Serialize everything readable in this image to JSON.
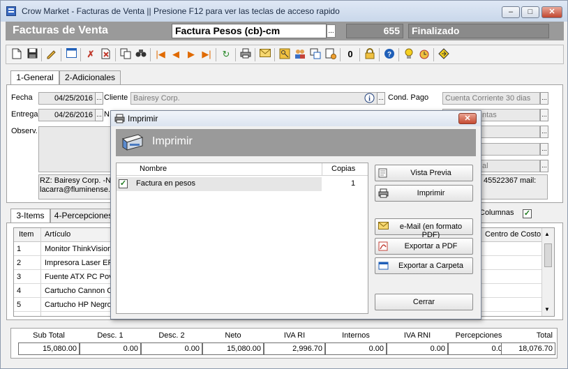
{
  "window": {
    "title": "Crow Market - Facturas de Venta || Presione F12 para ver las teclas de acceso rapido"
  },
  "header": {
    "title": "Facturas de Venta",
    "doc_type": "Factura Pesos (cb)-cm",
    "number": "655",
    "status": "Finalizado"
  },
  "tabs_top": [
    "1-General",
    "2-Adicionales"
  ],
  "form": {
    "fecha_label": "Fecha",
    "fecha": "04/25/2016",
    "entrega_label": "Entrega",
    "entrega": "04/26/2016",
    "observ_label": "Observ.",
    "cliente_label": "Cliente",
    "cliente": "Bairesy Corp.",
    "n_label": "N",
    "cond_pago_label": "Cond. Pago",
    "cond_pago": "Cuenta Corriente 30 dias",
    "right_field_2": "ntas",
    "right_field_5": "al",
    "rz_line1": "RZ: Bairesy Corp. -N:",
    "rz_line2": "lacarra@fluminense.c",
    "phone_fragment": "45522367 mail:"
  },
  "tabs_bottom": [
    "3-Items",
    "4-Percepciones"
  ],
  "items_grid": {
    "columns": [
      "Item",
      "Artículo"
    ],
    "rows": [
      {
        "item": "1",
        "articulo": "Monitor ThinkVision"
      },
      {
        "item": "2",
        "articulo": "Impresora Laser EPL"
      },
      {
        "item": "3",
        "articulo": "Fuente ATX PC Pov"
      },
      {
        "item": "4",
        "articulo": "Cartucho Cannon Co"
      },
      {
        "item": "5",
        "articulo": "Cartucho HP Negro"
      }
    ],
    "columnas_label": "Columnas",
    "centro_costo_label": "Centro de Costo"
  },
  "totals": [
    {
      "label": "Sub Total",
      "value": "15,080.00"
    },
    {
      "label": "Desc. 1",
      "value": "0.00"
    },
    {
      "label": "Desc. 2",
      "value": "0.00"
    },
    {
      "label": "Neto",
      "value": "15,080.00"
    },
    {
      "label": "IVA RI",
      "value": "2,996.70"
    },
    {
      "label": "Internos",
      "value": "0.00"
    },
    {
      "label": "IVA RNI",
      "value": "0.00"
    },
    {
      "label": "Percepciones",
      "value": "0.00"
    },
    {
      "label": "Total",
      "value": "18,076.70"
    }
  ],
  "dialog": {
    "title": "Imprimir",
    "heading": "Imprimir",
    "list_columns": {
      "nombre": "Nombre",
      "copias": "Copias"
    },
    "rows": [
      {
        "nombre": "Factura en pesos",
        "copias": "1",
        "checked": true
      }
    ],
    "buttons": {
      "vista_previa": "Vista Previa",
      "imprimir": "Imprimir",
      "email": "e-Mail (en formato PDF)",
      "exportar_pdf": "Exportar a PDF",
      "exportar_carpeta": "Exportar a Carpeta",
      "cerrar": "Cerrar"
    }
  },
  "colors": {
    "header_bg": "#9a9a9a",
    "accent": "#1f5fb8",
    "close_red": "#c44a32"
  }
}
